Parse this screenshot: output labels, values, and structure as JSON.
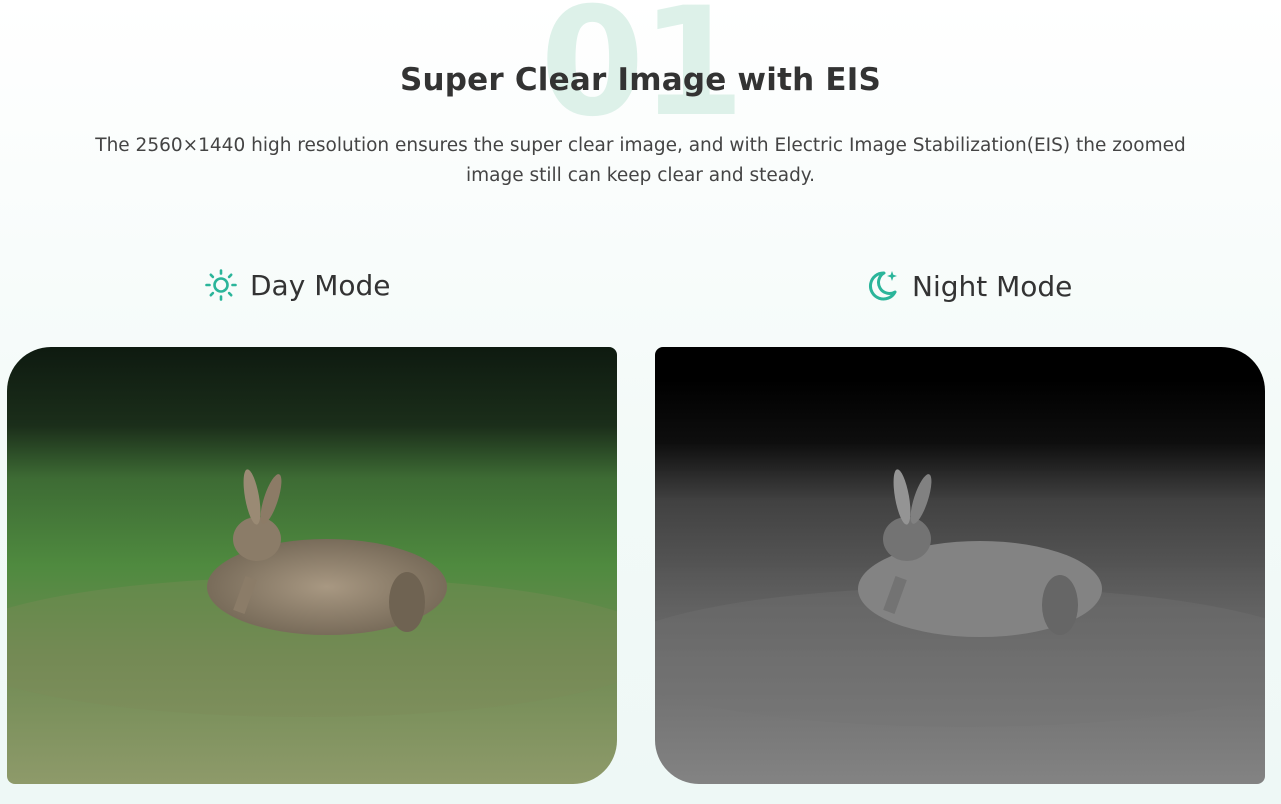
{
  "section": {
    "number": "01",
    "title": "Super Clear Image with EIS",
    "description": "The 2560×1440 high resolution ensures the super clear image, and with Electric Image Stabilization(EIS) the zoomed image still can keep clear and steady."
  },
  "modes": [
    {
      "label": "Day Mode",
      "icon": "sun-icon"
    },
    {
      "label": "Night Mode",
      "icon": "moon-icon"
    }
  ],
  "colors": {
    "accent": "#2bb59a",
    "heading": "#333333"
  }
}
